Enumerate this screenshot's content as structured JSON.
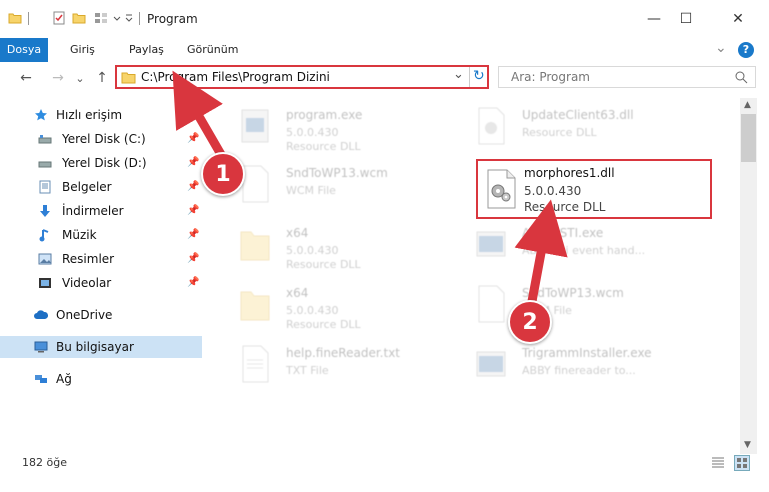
{
  "window": {
    "title": "Program",
    "minimize_glyph": "—",
    "maximize_glyph": "☐",
    "close_glyph": "✕"
  },
  "ribbon": {
    "tabs": [
      {
        "label": "Dosya",
        "active": true
      },
      {
        "label": "Giriş",
        "active": false
      },
      {
        "label": "Paylaş",
        "active": false
      },
      {
        "label": "Görünüm",
        "active": false
      }
    ],
    "expand_glyph": "⌄",
    "help_glyph": "?"
  },
  "nav": {
    "back_glyph": "←",
    "forward_glyph": "→",
    "history_glyph": "⌄",
    "up_glyph": "↑"
  },
  "address": {
    "path": "C:\\Program Files\\Program Dizini",
    "dropdown_glyph": "⌄",
    "refresh_glyph": "↻"
  },
  "search": {
    "placeholder": "Ara: Program",
    "icon": "search-icon"
  },
  "sidebar": {
    "items": [
      {
        "label": "Hızlı erişim",
        "icon": "star-icon",
        "pinned": false
      },
      {
        "label": "Yerel Disk (C:)",
        "icon": "drive-icon",
        "pinned": true
      },
      {
        "label": "Yerel Disk (D:)",
        "icon": "drive-icon",
        "pinned": true
      },
      {
        "label": "Belgeler",
        "icon": "documents-icon",
        "pinned": true
      },
      {
        "label": "İndirmeler",
        "icon": "download-icon",
        "pinned": true
      },
      {
        "label": "Müzik",
        "icon": "music-icon",
        "pinned": true
      },
      {
        "label": "Resimler",
        "icon": "pictures-icon",
        "pinned": true
      },
      {
        "label": "Videolar",
        "icon": "videos-icon",
        "pinned": true
      },
      {
        "label": "OneDrive",
        "icon": "cloud-icon",
        "pinned": false
      },
      {
        "label": "Bu bilgisayar",
        "icon": "computer-icon",
        "pinned": false,
        "selected": true
      },
      {
        "label": "Ağ",
        "icon": "network-icon",
        "pinned": false
      }
    ],
    "pin_glyph": "📌"
  },
  "files": [
    {
      "name": "program.exe",
      "line1": "5.0.0.430",
      "line2": "Resource DLL"
    },
    {
      "name": "UpdateClient63.dll",
      "line1": "Resource DLL",
      "line2": ""
    },
    {
      "name": "SndToWP13.wcm",
      "line1": "WCM File",
      "line2": ""
    },
    {
      "name": "x64",
      "line1": "5.0.0.430",
      "line2": "Resource DLL"
    },
    {
      "name": "AbbyySTI.exe",
      "line1": "ABBY Sti event hand...",
      "line2": ""
    },
    {
      "name": "x64",
      "line1": "5.0.0.430",
      "line2": "Resource DLL"
    },
    {
      "name": "SndToWP13.wcm",
      "line1": "WCM File",
      "line2": ""
    },
    {
      "name": "help.fineReader.txt",
      "line1": "TXT File",
      "line2": ""
    },
    {
      "name": "TrigrammInstaller.exe",
      "line1": "ABBY finereader to...",
      "line2": ""
    }
  ],
  "highlighted_file": {
    "name": "morphores1.dll",
    "version": "5.0.0.430",
    "type": "Resource DLL"
  },
  "status": {
    "item_count": "182 öğe"
  },
  "annotations": {
    "step1": "1",
    "step2": "2",
    "color": "#d9363e"
  },
  "colors": {
    "accent": "#1979ca",
    "highlight": "#d9363e",
    "selected_bg": "#cce2f5"
  }
}
